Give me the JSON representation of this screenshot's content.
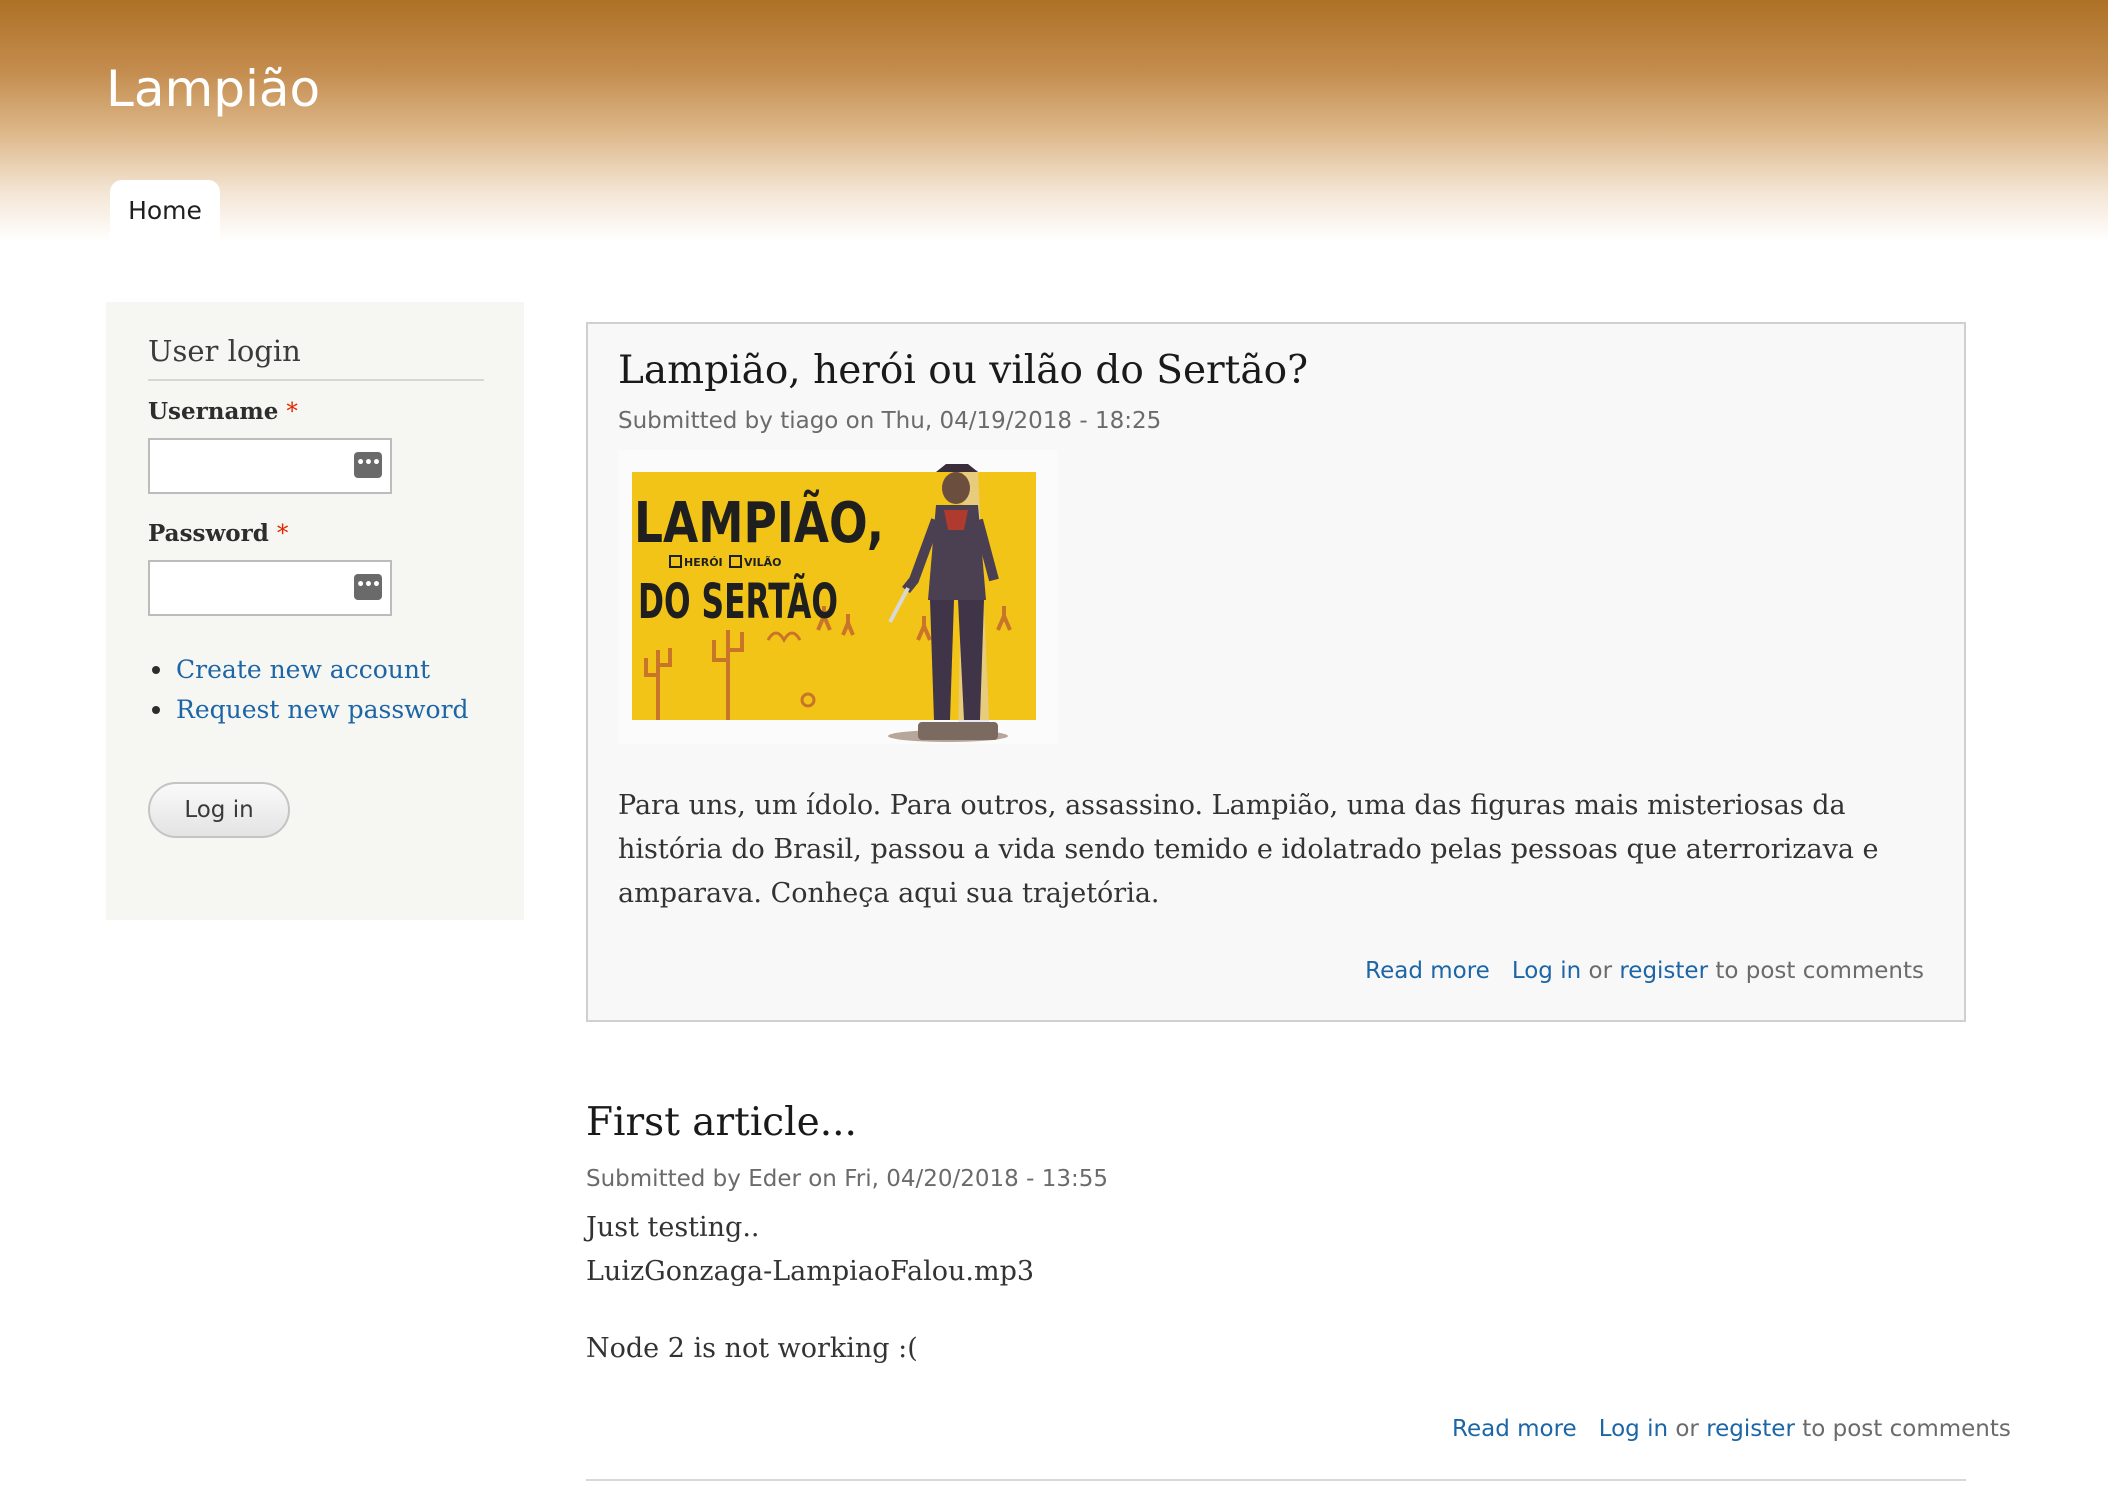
{
  "site": {
    "name": "Lampião"
  },
  "nav": {
    "home_label": "Home"
  },
  "login_block": {
    "title": "User login",
    "username_label": "Username",
    "password_label": "Password",
    "required_marker": "*",
    "username_value": "",
    "password_value": "",
    "create_account_label": "Create new account",
    "request_password_label": "Request new password",
    "login_button_label": "Log in"
  },
  "articles": [
    {
      "title": "Lampião, herói ou vilão do Sertão?",
      "meta": "Submitted by tiago on Thu, 04/19/2018 - 18:25",
      "image": {
        "line1": "LAMPIÃO,",
        "option1": "HERÓI",
        "option2": "VILÃO",
        "line2": "DO SERTÃO"
      },
      "body": "Para uns, um ídolo. Para outros, assassino. Lampião, uma das figuras mais misteriosas da história do Brasil, passou a vida sendo temido e idolatrado pelas pessoas que aterrorizava e amparava. Conheça aqui sua trajetória.",
      "read_more": "Read more",
      "login": "Log in",
      "or": "or",
      "register": "register",
      "post_comments": "to post comments"
    },
    {
      "title": "First article...",
      "meta": "Submitted by Eder on Fri, 04/20/2018 - 13:55",
      "body_line1": "Just testing..",
      "body_line2": "LuizGonzaga-LampiaoFalou.mp3",
      "body_line3": "Node 2 is not working :(",
      "read_more": "Read more",
      "login": "Log in",
      "or": "or",
      "register": "register",
      "post_comments": "to post comments"
    }
  ],
  "colors": {
    "header_top": "#ae7126",
    "link": "#1c65a6",
    "required": "#e32700",
    "sidebar_bg": "#f6f6f2",
    "poster_yellow": "#f2c417"
  },
  "icons": {
    "password_manager": "password-manager-icon"
  }
}
